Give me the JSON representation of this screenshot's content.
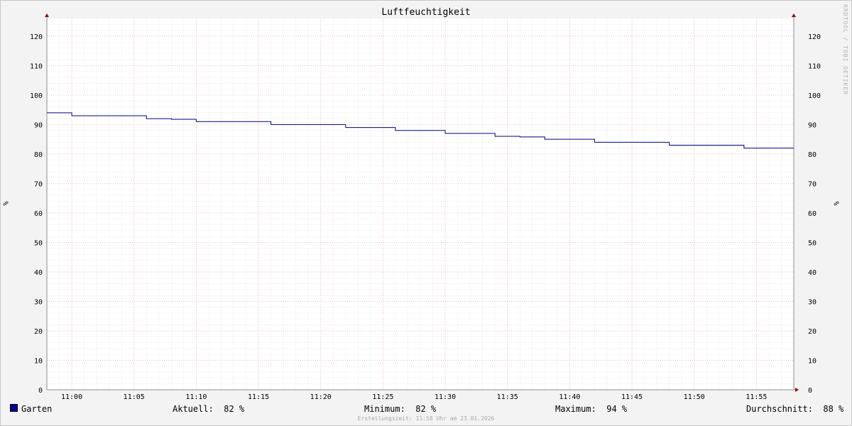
{
  "chart_data": {
    "type": "line",
    "title": "Luftfeuchtigkeit",
    "ylabel": "%",
    "ylim": [
      0,
      126
    ],
    "yticks": [
      0,
      10,
      20,
      30,
      40,
      50,
      60,
      70,
      80,
      90,
      100,
      110,
      120
    ],
    "xticks": [
      "11:00",
      "11:05",
      "11:10",
      "11:15",
      "11:20",
      "11:25",
      "11:30",
      "11:35",
      "11:40",
      "11:45",
      "11:50",
      "11:55"
    ],
    "xrange": [
      "10:58",
      "11:58"
    ],
    "grid": true,
    "series": [
      {
        "name": "Garten",
        "color": "#000080",
        "x": [
          "10:58",
          "11:00",
          "11:06",
          "11:08",
          "11:10",
          "11:16",
          "11:22",
          "11:26",
          "11:30",
          "11:34",
          "11:36",
          "11:38",
          "11:42",
          "11:48",
          "11:54",
          "11:58"
        ],
        "values": [
          94,
          93,
          92,
          91.8,
          91,
          90,
          89,
          88,
          87,
          86,
          85.8,
          85,
          84,
          83,
          82,
          82
        ]
      }
    ]
  },
  "legend": {
    "series_name": "Garten",
    "swatch_color": "#0000a0",
    "current": "Aktuell:  82 %",
    "minimum": "Minimum:  82 %",
    "maximum": "Maximum:  94 %",
    "average": "Durchschnitt:  88 %"
  },
  "watermark": "RRDTOOL / TOBI OETIKER",
  "footer": "Erstellungszeit: 11:58 Uhr am 23.01.2026"
}
